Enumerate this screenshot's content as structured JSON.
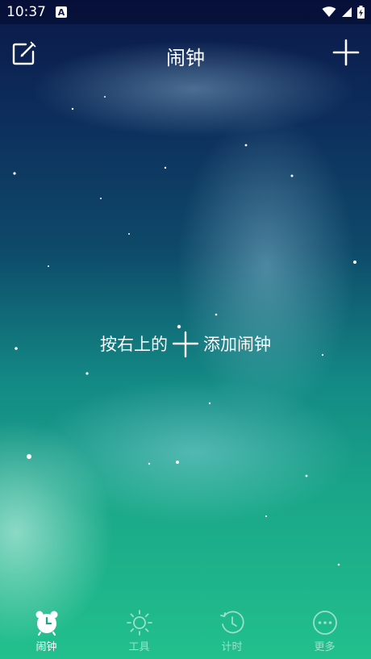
{
  "status_bar": {
    "time": "10:37",
    "notification_badge": "A"
  },
  "header": {
    "title": "闹钟"
  },
  "empty_state": {
    "hint_prefix": "按右上的",
    "hint_suffix": "添加闹钟"
  },
  "tabs": [
    {
      "label": "闹钟",
      "icon": "alarm-clock-icon",
      "active": true
    },
    {
      "label": "工具",
      "icon": "sun-icon",
      "active": false
    },
    {
      "label": "计时",
      "icon": "timer-icon",
      "active": false
    },
    {
      "label": "更多",
      "icon": "more-icon",
      "active": false
    }
  ],
  "colors": {
    "background_top": "#0a1848",
    "background_bottom": "#22c08c",
    "text": "#ffffff"
  }
}
